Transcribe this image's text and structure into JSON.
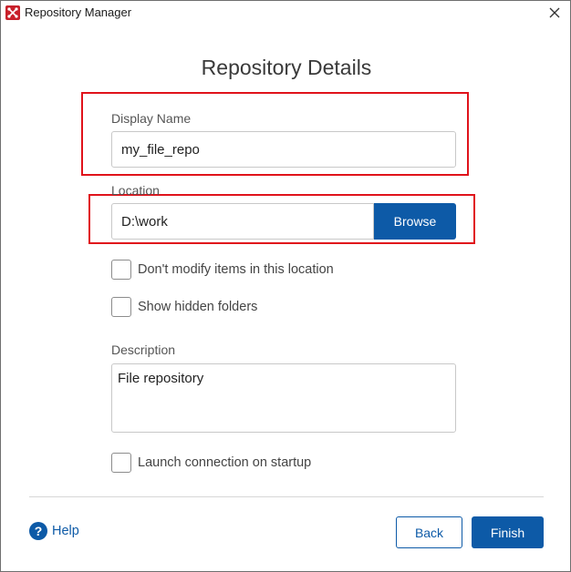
{
  "window": {
    "title": "Repository Manager"
  },
  "page": {
    "heading": "Repository Details"
  },
  "display_name": {
    "label": "Display Name",
    "value": "my_file_repo"
  },
  "location": {
    "label": "Location",
    "value": "D:\\work",
    "browse_label": "Browse"
  },
  "options": {
    "dont_modify_label": "Don't modify items in this location",
    "dont_modify_checked": false,
    "show_hidden_label": "Show hidden folders",
    "show_hidden_checked": false
  },
  "description": {
    "label": "Description",
    "value": "File repository"
  },
  "startup": {
    "label": "Launch connection on startup",
    "checked": false
  },
  "footer": {
    "help_label": "Help",
    "back_label": "Back",
    "finish_label": "Finish"
  },
  "colors": {
    "accent": "#0d5aa7",
    "highlight": "#e0131b",
    "app_icon": "#c8202a"
  }
}
